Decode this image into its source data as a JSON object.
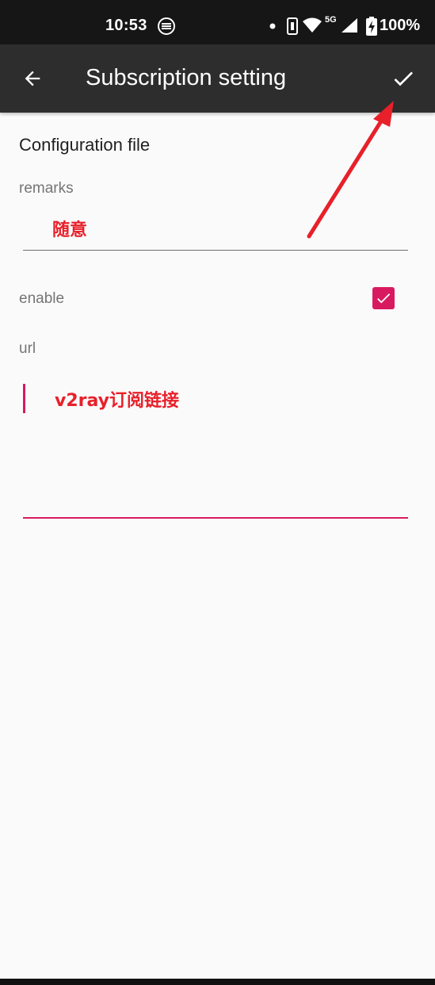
{
  "status_bar": {
    "time": "10:53",
    "battery": "100%",
    "network": "5G",
    "icons": [
      "hd-voice-icon",
      "dot-icon",
      "vibrate-icon",
      "wifi-icon",
      "signal-icon",
      "battery-charging-icon"
    ]
  },
  "app_bar": {
    "title": "Subscription setting",
    "back_icon": "arrow-back-icon",
    "confirm_icon": "check-icon"
  },
  "form": {
    "section_title": "Configuration file",
    "remarks_label": "remarks",
    "remarks_value": "随意",
    "enable_label": "enable",
    "enable_checked": true,
    "url_label": "url",
    "url_value": "v2ray订阅链接"
  },
  "colors": {
    "accent": "#d81b60",
    "annotation_red": "#e8202a",
    "app_bar_bg": "#2d2d2d",
    "status_bar_bg": "#161616",
    "page_bg": "#fafafa"
  }
}
